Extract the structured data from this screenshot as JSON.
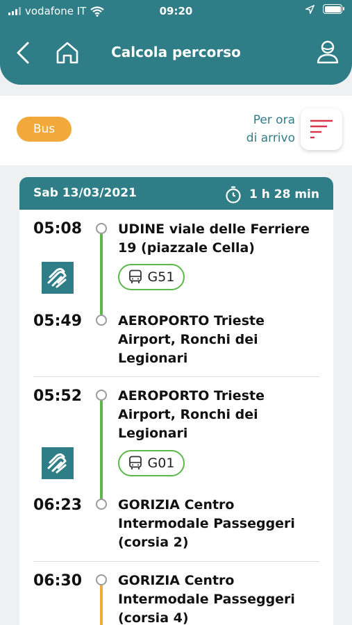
{
  "status": {
    "carrier": "vodafone IT",
    "time": "09:20"
  },
  "header": {
    "title": "Calcola percorso"
  },
  "filter": {
    "mode_label": "Bus",
    "sort_label_line1": "Per ora",
    "sort_label_line2": "di arrivo"
  },
  "trip": {
    "date": "Sab 13/03/2021",
    "duration": "1 h 28 min",
    "legs": [
      {
        "dep_time": "05:08",
        "dep_stop": "UDINE viale delle Ferriere 19 (piazzale Cella)",
        "route": "G51",
        "arr_time": "05:49",
        "arr_stop": "AEROPORTO Trieste Airport, Ronchi dei Legionari",
        "line_color": "#5cb84a"
      },
      {
        "dep_time": "05:52",
        "dep_stop": "AEROPORTO Trieste Airport, Ronchi dei Legionari",
        "route": "G01",
        "arr_time": "06:23",
        "arr_stop": "GORIZIA Centro Intermodale Passeggeri (corsia 2)",
        "line_color": "#5cb84a"
      },
      {
        "dep_time": "06:30",
        "dep_stop": "GORIZIA Centro Intermodale Passeggeri (corsia 4)",
        "line_color": "#f0a93a"
      }
    ]
  },
  "colors": {
    "primary": "#2f7d86",
    "accent": "#f0a93a",
    "route_green": "#5cb84a",
    "sort_red": "#d9344a"
  }
}
